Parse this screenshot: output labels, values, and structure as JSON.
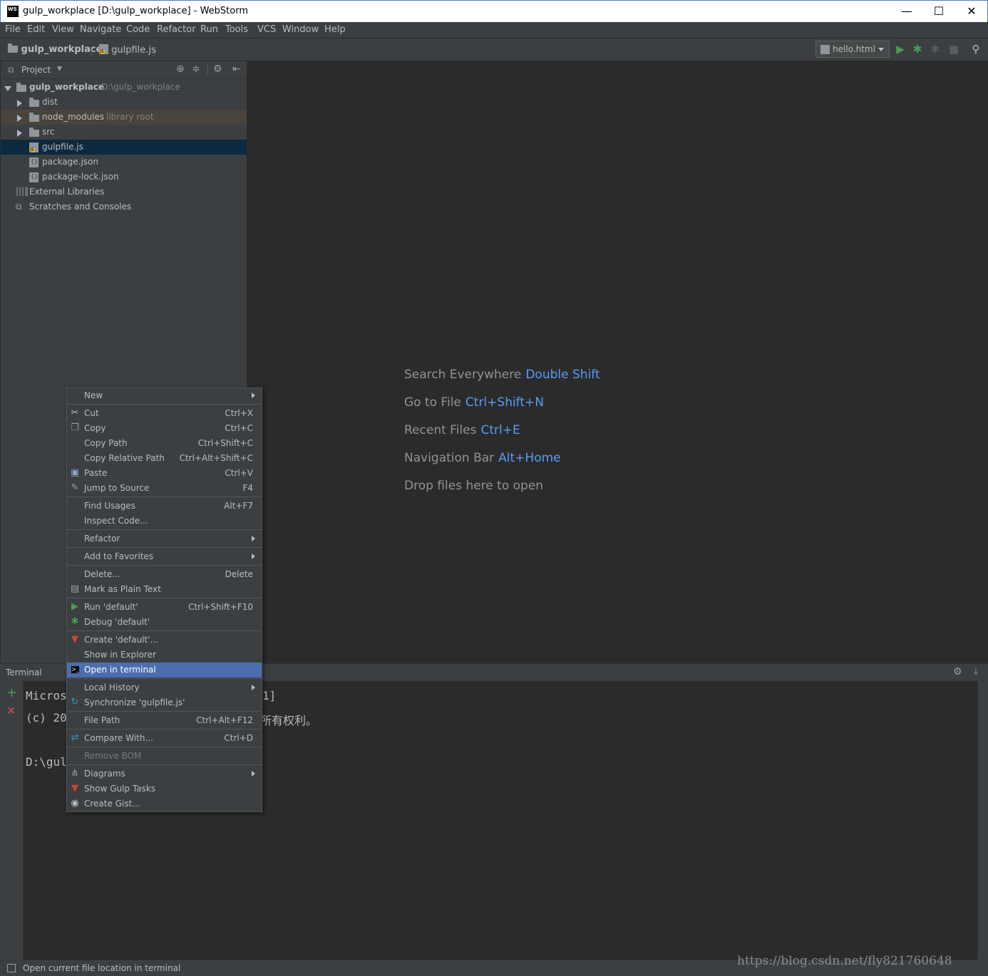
{
  "window": {
    "title": "gulp_workplace [D:\\gulp_workplace] - WebStorm",
    "app_icon_text": "WS",
    "minimize": "—",
    "maximize": "☐",
    "close": "✕"
  },
  "menu": [
    "File",
    "Edit",
    "View",
    "Navigate",
    "Code",
    "Refactor",
    "Run",
    "Tools",
    "VCS",
    "Window",
    "Help"
  ],
  "navbar": {
    "project": "gulp_workplace",
    "file": "gulpfile.js",
    "run_config": "hello.html"
  },
  "project_panel": {
    "header": "Project",
    "tree": [
      {
        "label": "gulp_workplace",
        "sub": "D:\\gulp_workplace",
        "bold": true
      },
      {
        "label": "dist",
        "sub": ""
      },
      {
        "label": "node_modules",
        "sub": "library root"
      },
      {
        "label": "src",
        "sub": ""
      },
      {
        "label": "gulpfile.js",
        "sub": ""
      },
      {
        "label": "package.json",
        "sub": ""
      },
      {
        "label": "package-lock.json",
        "sub": ""
      },
      {
        "label": "External Libraries",
        "sub": ""
      },
      {
        "label": "Scratches and Consoles",
        "sub": ""
      }
    ]
  },
  "editor_hints": [
    {
      "text": "Search Everywhere",
      "key": "Double Shift"
    },
    {
      "text": "Go to File",
      "key": "Ctrl+Shift+N"
    },
    {
      "text": "Recent Files",
      "key": "Ctrl+E"
    },
    {
      "text": "Navigation Bar",
      "key": "Alt+Home"
    },
    {
      "text": "Drop files here to open",
      "key": ""
    }
  ],
  "terminal": {
    "header": "Terminal",
    "lines": [
      "Micros",
      "(c) 20",
      "",
      "D:\\gul"
    ],
    "lines_right": [
      "1]",
      "所有权利。"
    ]
  },
  "context_menu": {
    "items": [
      {
        "label": "New",
        "shortcut": ""
      },
      {
        "label": "Cut",
        "shortcut": "Ctrl+X"
      },
      {
        "label": "Copy",
        "shortcut": "Ctrl+C"
      },
      {
        "label": "Copy Path",
        "shortcut": "Ctrl+Shift+C"
      },
      {
        "label": "Copy Relative Path",
        "shortcut": "Ctrl+Alt+Shift+C"
      },
      {
        "label": "Paste",
        "shortcut": "Ctrl+V"
      },
      {
        "label": "Jump to Source",
        "shortcut": "F4"
      },
      {
        "label": "Find Usages",
        "shortcut": "Alt+F7"
      },
      {
        "label": "Inspect Code...",
        "shortcut": ""
      },
      {
        "label": "Refactor",
        "shortcut": ""
      },
      {
        "label": "Add to Favorites",
        "shortcut": ""
      },
      {
        "label": "Delete...",
        "shortcut": "Delete"
      },
      {
        "label": "Mark as Plain Text",
        "shortcut": ""
      },
      {
        "label": "Run 'default'",
        "shortcut": "Ctrl+Shift+F10"
      },
      {
        "label": "Debug 'default'",
        "shortcut": ""
      },
      {
        "label": "Create 'default'...",
        "shortcut": ""
      },
      {
        "label": "Show in Explorer",
        "shortcut": ""
      },
      {
        "label": "Open in terminal",
        "shortcut": ""
      },
      {
        "label": "Local History",
        "shortcut": ""
      },
      {
        "label": "Synchronize 'gulpfile.js'",
        "shortcut": ""
      },
      {
        "label": "File Path",
        "shortcut": "Ctrl+Alt+F12"
      },
      {
        "label": "Compare With...",
        "shortcut": "Ctrl+D"
      },
      {
        "label": "Remove BOM",
        "shortcut": ""
      },
      {
        "label": "Diagrams",
        "shortcut": ""
      },
      {
        "label": "Show Gulp Tasks",
        "shortcut": ""
      },
      {
        "label": "Create Gist...",
        "shortcut": ""
      }
    ]
  },
  "status_bar": {
    "text": "Open current file location in terminal"
  },
  "watermark": "https://blog.csdn.net/fly821760648",
  "colors": {
    "accent": "#589df6",
    "selection": "#4b6eaf",
    "run_green": "#499c54"
  }
}
